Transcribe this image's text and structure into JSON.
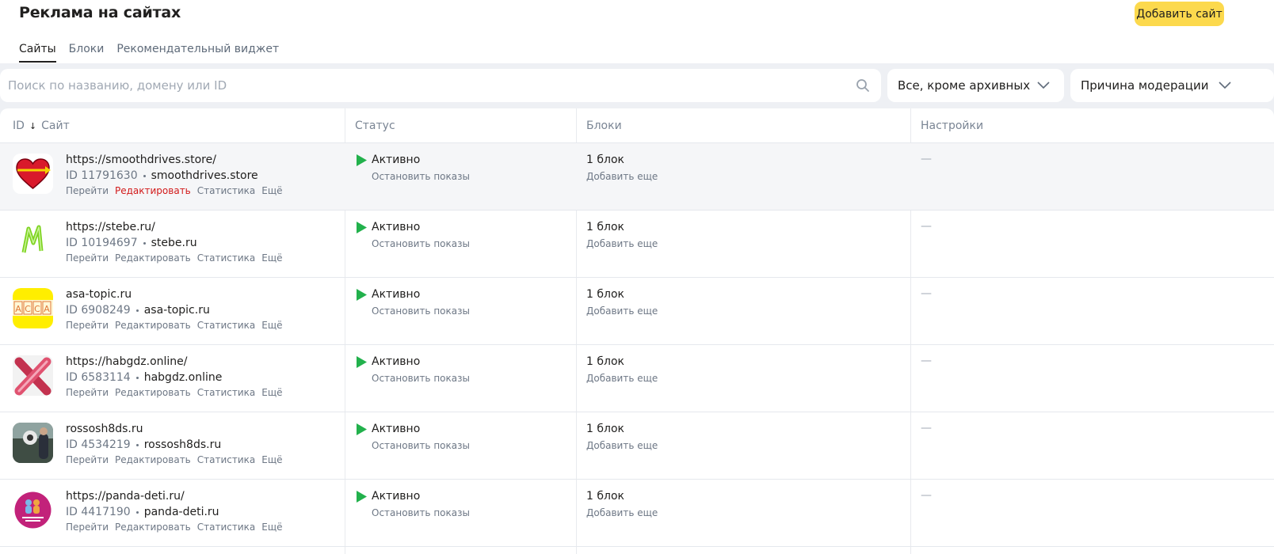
{
  "header": {
    "title": "Реклама на сайтах",
    "add_site_label": "Добавить сайт",
    "tabs": [
      {
        "label": "Сайты",
        "active": true
      },
      {
        "label": "Блоки",
        "active": false
      },
      {
        "label": "Рекомендательный виджет",
        "active": false
      }
    ]
  },
  "filters": {
    "search_placeholder": "Поиск по названию, домену или ID",
    "search_value": "",
    "status_selected": "Все, кроме архивных",
    "moderation_selected": "Причина модерации"
  },
  "table": {
    "columns": {
      "id": "ID",
      "sort_arrow": "↓",
      "site": "Сайт",
      "status": "Статус",
      "blocks": "Блоки",
      "settings": "Настройки"
    },
    "action_labels": {
      "go": "Перейти",
      "edit": "Редактировать",
      "stats": "Статистика",
      "more": "Ещё"
    },
    "stop_label": "Остановить показы",
    "add_more_label": "Добавить еще",
    "empty_placeholder": "—",
    "rows": [
      {
        "url": "https://smoothdrives.store/",
        "id": "ID 11791630",
        "domain": "smoothdrives.store",
        "status": "Активно",
        "blocks": "1 блок",
        "icon": "heart-arrow-icon",
        "highlighted": true
      },
      {
        "url": "https://stebe.ru/",
        "id": "ID 10194697",
        "domain": "stebe.ru",
        "status": "Активно",
        "blocks": "1 блок",
        "icon": "green-m-logo-icon",
        "highlighted": false
      },
      {
        "url": "asa-topic.ru",
        "id": "ID 6908249",
        "domain": "asa-topic.ru",
        "status": "Активно",
        "blocks": "1 блок",
        "icon": "acca-logo-icon",
        "highlighted": false
      },
      {
        "url": "https://habgdz.online/",
        "id": "ID 6583114",
        "domain": "habgdz.online",
        "status": "Активно",
        "blocks": "1 блок",
        "icon": "pink-x-icon",
        "highlighted": false
      },
      {
        "url": "rossosh8ds.ru",
        "id": "ID 4534219",
        "domain": "rossosh8ds.ru",
        "status": "Активно",
        "blocks": "1 блок",
        "icon": "photo-thumbnail-icon",
        "highlighted": false
      },
      {
        "url": "https://panda-deti.ru/",
        "id": "ID 4417190",
        "domain": "panda-deti.ru",
        "status": "Активно",
        "blocks": "1 блок",
        "icon": "panda-deti-logo-icon",
        "highlighted": false
      }
    ]
  },
  "colors": {
    "accent_yellow": "#fcd94d",
    "active_green": "#22b14c",
    "edit_highlight_red": "#d21a1a"
  }
}
